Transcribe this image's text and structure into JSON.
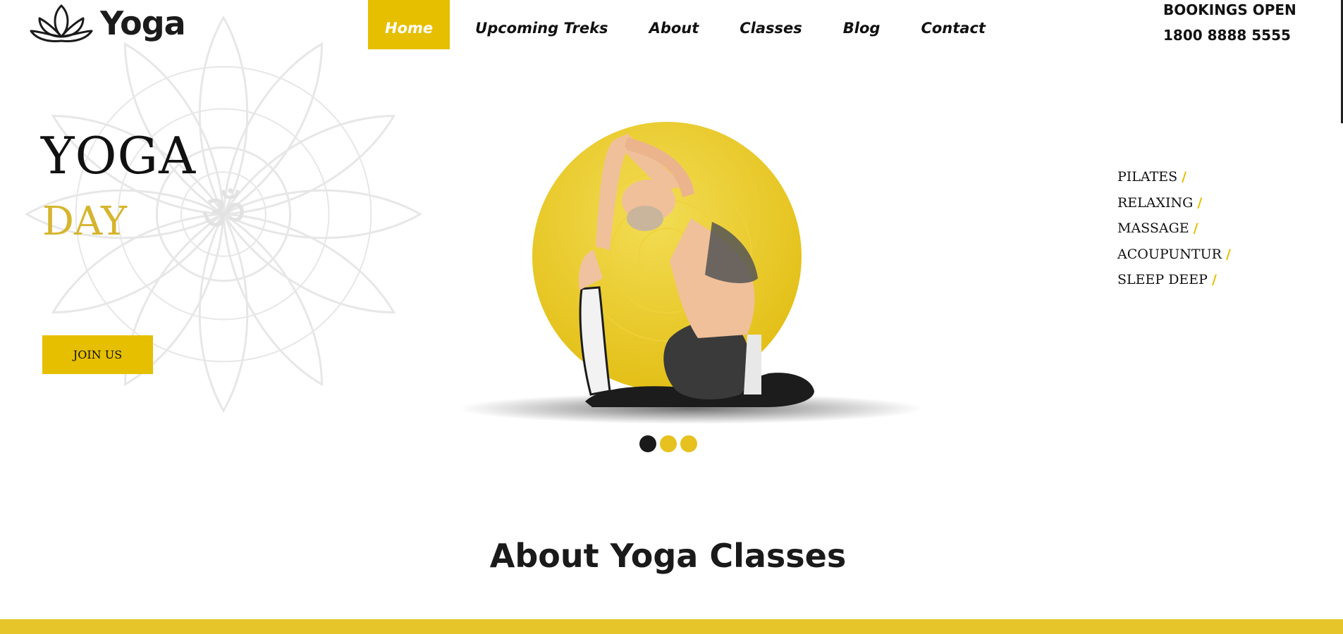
{
  "logo": {
    "text": "Yoga",
    "icon": "lotus-icon"
  },
  "nav": {
    "items": [
      {
        "label": "Home",
        "active": true
      },
      {
        "label": "Upcoming Treks",
        "active": false
      },
      {
        "label": "About",
        "active": false
      },
      {
        "label": "Classes",
        "active": false
      },
      {
        "label": "Blog",
        "active": false
      },
      {
        "label": "Contact",
        "active": false
      }
    ]
  },
  "booking": {
    "label": "BOOKINGS OPEN",
    "phone": "1800 8888 5555"
  },
  "hero": {
    "title": "YOGA",
    "subtitle": "DAY",
    "cta_label": "JOIN US",
    "background_icon": "mandala-om-icon",
    "image_icon": "yoga-pose-illustration"
  },
  "slider": {
    "count": 3,
    "active_index": 0
  },
  "classes": [
    {
      "label": "PILATES",
      "sep": "/"
    },
    {
      "label": "RELAXING",
      "sep": "/"
    },
    {
      "label": "MASSAGE",
      "sep": "/"
    },
    {
      "label": "ACOUPUNTUR",
      "sep": "/"
    },
    {
      "label": "SLEEP DEEP",
      "sep": "/"
    }
  ],
  "about": {
    "heading": "About Yoga Classes"
  },
  "colors": {
    "accent": "#e6bf00",
    "subtitle": "#d6b52e",
    "dark": "#111111"
  }
}
